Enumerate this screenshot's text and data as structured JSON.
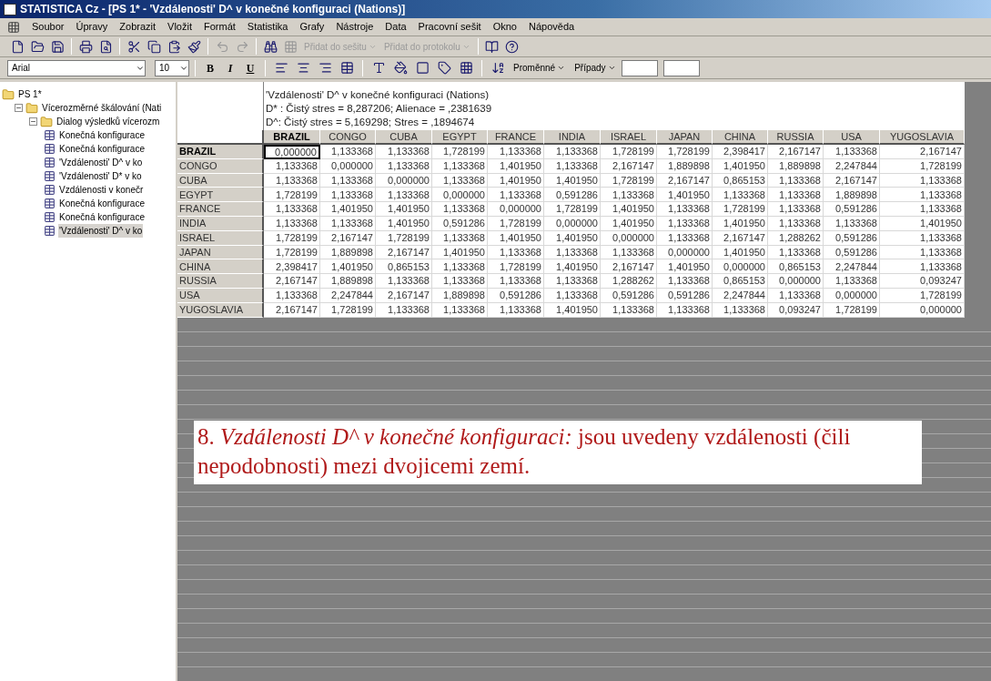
{
  "window": {
    "title": "STATISTICA Cz - [PS 1* - 'Vzdálenosti' D^ v konečné konfiguraci (Nations)]"
  },
  "menu": [
    "Soubor",
    "Úpravy",
    "Zobrazit",
    "Vložit",
    "Formát",
    "Statistika",
    "Grafy",
    "Nástroje",
    "Data",
    "Pracovní sešit",
    "Okno",
    "Nápověda"
  ],
  "toolbar": {
    "buttons": [
      {
        "label": "Přidat do sešitu",
        "disabled": true
      },
      {
        "label": "Přidat do protokolu",
        "disabled": true
      }
    ]
  },
  "format_toolbar": {
    "font": "Arial",
    "size": "10",
    "bold": "B",
    "italic": "I",
    "underline": "U",
    "dropdowns": [
      "Proměnné",
      "Případy"
    ]
  },
  "tree": [
    {
      "label": "PS 1*",
      "selected": false,
      "children": [
        {
          "label": "Vícerozměrné škálování (Nati",
          "expanded": true,
          "selected": false,
          "children": [
            {
              "label": "Dialog výsledků vícerozm",
              "expanded": true,
              "selected": false,
              "children": [
                {
                  "label": "Konečná konfigurace",
                  "selected": false
                },
                {
                  "label": "Konečná konfigurace",
                  "selected": false
                },
                {
                  "label": "'Vzdálenosti' D^ v ko",
                  "selected": false
                },
                {
                  "label": "'Vzdálenosti' D* v ko",
                  "selected": false
                },
                {
                  "label": "Vzdálenosti v konečr",
                  "selected": false
                },
                {
                  "label": "Konečná konfigurace",
                  "selected": false
                },
                {
                  "label": "Konečná konfigurace",
                  "selected": false
                },
                {
                  "label": "'Vzdálenosti' D^ v ko",
                  "selected": true
                }
              ]
            }
          ]
        }
      ]
    }
  ],
  "table": {
    "title_lines": [
      "'Vzdálenosti' D^ v konečné konfiguraci (Nations)",
      "D* : Čistý stres = 8,287206; Alienace = ,2381639",
      "D^: Čistý stres = 5,169298; Stres = ,1894674"
    ],
    "columns": [
      "BRAZIL",
      "CONGO",
      "CUBA",
      "EGYPT",
      "FRANCE",
      "INDIA",
      "ISRAEL",
      "JAPAN",
      "CHINA",
      "RUSSIA",
      "USA",
      "YUGOSLAVIA"
    ],
    "rows": [
      {
        "label": "BRAZIL",
        "cells": [
          {
            "value": "0,000000",
            "selected": true
          },
          {
            "value": "1,133368",
            "selected": false
          },
          {
            "value": "1,133368",
            "selected": false
          },
          {
            "value": "1,728199",
            "selected": false
          },
          {
            "value": "1,133368",
            "selected": false
          },
          {
            "value": "1,133368",
            "selected": false
          },
          {
            "value": "1,728199",
            "selected": false
          },
          {
            "value": "1,728199",
            "selected": false
          },
          {
            "value": "2,398417",
            "selected": false
          },
          {
            "value": "2,167147",
            "selected": false
          },
          {
            "value": "1,133368",
            "selected": false
          },
          {
            "value": "2,167147",
            "selected": false
          }
        ]
      },
      {
        "label": "CONGO",
        "cells": [
          {
            "value": "1,133368",
            "selected": false
          },
          {
            "value": "0,000000",
            "selected": false
          },
          {
            "value": "1,133368",
            "selected": false
          },
          {
            "value": "1,133368",
            "selected": false
          },
          {
            "value": "1,401950",
            "selected": false
          },
          {
            "value": "1,133368",
            "selected": false
          },
          {
            "value": "2,167147",
            "selected": false
          },
          {
            "value": "1,889898",
            "selected": false
          },
          {
            "value": "1,401950",
            "selected": false
          },
          {
            "value": "1,889898",
            "selected": false
          },
          {
            "value": "2,247844",
            "selected": false
          },
          {
            "value": "1,728199",
            "selected": false
          }
        ]
      },
      {
        "label": "CUBA",
        "cells": [
          {
            "value": "1,133368",
            "selected": false
          },
          {
            "value": "1,133368",
            "selected": false
          },
          {
            "value": "0,000000",
            "selected": false
          },
          {
            "value": "1,133368",
            "selected": false
          },
          {
            "value": "1,401950",
            "selected": false
          },
          {
            "value": "1,401950",
            "selected": false
          },
          {
            "value": "1,728199",
            "selected": false
          },
          {
            "value": "2,167147",
            "selected": false
          },
          {
            "value": "0,865153",
            "selected": false
          },
          {
            "value": "1,133368",
            "selected": false
          },
          {
            "value": "2,167147",
            "selected": false
          },
          {
            "value": "1,133368",
            "selected": false
          }
        ]
      },
      {
        "label": "EGYPT",
        "cells": [
          {
            "value": "1,728199",
            "selected": false
          },
          {
            "value": "1,133368",
            "selected": false
          },
          {
            "value": "1,133368",
            "selected": false
          },
          {
            "value": "0,000000",
            "selected": false
          },
          {
            "value": "1,133368",
            "selected": false
          },
          {
            "value": "0,591286",
            "selected": false
          },
          {
            "value": "1,133368",
            "selected": false
          },
          {
            "value": "1,401950",
            "selected": false
          },
          {
            "value": "1,133368",
            "selected": false
          },
          {
            "value": "1,133368",
            "selected": false
          },
          {
            "value": "1,889898",
            "selected": false
          },
          {
            "value": "1,133368",
            "selected": false
          }
        ]
      },
      {
        "label": "FRANCE",
        "cells": [
          {
            "value": "1,133368",
            "selected": false
          },
          {
            "value": "1,401950",
            "selected": false
          },
          {
            "value": "1,401950",
            "selected": false
          },
          {
            "value": "1,133368",
            "selected": false
          },
          {
            "value": "0,000000",
            "selected": false
          },
          {
            "value": "1,728199",
            "selected": false
          },
          {
            "value": "1,401950",
            "selected": false
          },
          {
            "value": "1,133368",
            "selected": false
          },
          {
            "value": "1,728199",
            "selected": false
          },
          {
            "value": "1,133368",
            "selected": false
          },
          {
            "value": "0,591286",
            "selected": false
          },
          {
            "value": "1,133368",
            "selected": false
          }
        ]
      },
      {
        "label": "INDIA",
        "cells": [
          {
            "value": "1,133368",
            "selected": false
          },
          {
            "value": "1,133368",
            "selected": false
          },
          {
            "value": "1,401950",
            "selected": false
          },
          {
            "value": "0,591286",
            "selected": false
          },
          {
            "value": "1,728199",
            "selected": false
          },
          {
            "value": "0,000000",
            "selected": false
          },
          {
            "value": "1,401950",
            "selected": false
          },
          {
            "value": "1,133368",
            "selected": false
          },
          {
            "value": "1,401950",
            "selected": false
          },
          {
            "value": "1,133368",
            "selected": false
          },
          {
            "value": "1,133368",
            "selected": false
          },
          {
            "value": "1,401950",
            "selected": false
          }
        ]
      },
      {
        "label": "ISRAEL",
        "cells": [
          {
            "value": "1,728199",
            "selected": false
          },
          {
            "value": "2,167147",
            "selected": false
          },
          {
            "value": "1,728199",
            "selected": false
          },
          {
            "value": "1,133368",
            "selected": false
          },
          {
            "value": "1,401950",
            "selected": false
          },
          {
            "value": "1,401950",
            "selected": false
          },
          {
            "value": "0,000000",
            "selected": false
          },
          {
            "value": "1,133368",
            "selected": false
          },
          {
            "value": "2,167147",
            "selected": false
          },
          {
            "value": "1,288262",
            "selected": false
          },
          {
            "value": "0,591286",
            "selected": false
          },
          {
            "value": "1,133368",
            "selected": false
          }
        ]
      },
      {
        "label": "JAPAN",
        "cells": [
          {
            "value": "1,728199",
            "selected": false
          },
          {
            "value": "1,889898",
            "selected": false
          },
          {
            "value": "2,167147",
            "selected": false
          },
          {
            "value": "1,401950",
            "selected": false
          },
          {
            "value": "1,133368",
            "selected": false
          },
          {
            "value": "1,133368",
            "selected": false
          },
          {
            "value": "1,133368",
            "selected": false
          },
          {
            "value": "0,000000",
            "selected": false
          },
          {
            "value": "1,401950",
            "selected": false
          },
          {
            "value": "1,133368",
            "selected": false
          },
          {
            "value": "0,591286",
            "selected": false
          },
          {
            "value": "1,133368",
            "selected": false
          }
        ]
      },
      {
        "label": "CHINA",
        "cells": [
          {
            "value": "2,398417",
            "selected": false
          },
          {
            "value": "1,401950",
            "selected": false
          },
          {
            "value": "0,865153",
            "selected": false
          },
          {
            "value": "1,133368",
            "selected": false
          },
          {
            "value": "1,728199",
            "selected": false
          },
          {
            "value": "1,401950",
            "selected": false
          },
          {
            "value": "2,167147",
            "selected": false
          },
          {
            "value": "1,401950",
            "selected": false
          },
          {
            "value": "0,000000",
            "selected": false
          },
          {
            "value": "0,865153",
            "selected": false
          },
          {
            "value": "2,247844",
            "selected": false
          },
          {
            "value": "1,133368",
            "selected": false
          }
        ]
      },
      {
        "label": "RUSSIA",
        "cells": [
          {
            "value": "2,167147",
            "selected": false
          },
          {
            "value": "1,889898",
            "selected": false
          },
          {
            "value": "1,133368",
            "selected": false
          },
          {
            "value": "1,133368",
            "selected": false
          },
          {
            "value": "1,133368",
            "selected": false
          },
          {
            "value": "1,133368",
            "selected": false
          },
          {
            "value": "1,288262",
            "selected": false
          },
          {
            "value": "1,133368",
            "selected": false
          },
          {
            "value": "0,865153",
            "selected": false
          },
          {
            "value": "0,000000",
            "selected": false
          },
          {
            "value": "1,133368",
            "selected": false
          },
          {
            "value": "0,093247",
            "selected": false
          }
        ]
      },
      {
        "label": "USA",
        "cells": [
          {
            "value": "1,133368",
            "selected": false
          },
          {
            "value": "2,247844",
            "selected": false
          },
          {
            "value": "2,167147",
            "selected": false
          },
          {
            "value": "1,889898",
            "selected": false
          },
          {
            "value": "0,591286",
            "selected": false
          },
          {
            "value": "1,133368",
            "selected": false
          },
          {
            "value": "0,591286",
            "selected": false
          },
          {
            "value": "0,591286",
            "selected": false
          },
          {
            "value": "2,247844",
            "selected": false
          },
          {
            "value": "1,133368",
            "selected": false
          },
          {
            "value": "0,000000",
            "selected": false
          },
          {
            "value": "1,728199",
            "selected": false
          }
        ]
      },
      {
        "label": "YUGOSLAVIA",
        "cells": [
          {
            "value": "2,167147",
            "selected": false
          },
          {
            "value": "1,728199",
            "selected": false
          },
          {
            "value": "1,133368",
            "selected": false
          },
          {
            "value": "1,133368",
            "selected": false
          },
          {
            "value": "1,133368",
            "selected": false
          },
          {
            "value": "1,401950",
            "selected": false
          },
          {
            "value": "1,133368",
            "selected": false
          },
          {
            "value": "1,133368",
            "selected": false
          },
          {
            "value": "1,133368",
            "selected": false
          },
          {
            "value": "0,093247",
            "selected": false
          },
          {
            "value": "1,728199",
            "selected": false
          },
          {
            "value": "0,000000",
            "selected": false
          }
        ]
      }
    ]
  },
  "caption": "8. *Vzdálenosti D^ v konečné konfiguraci:* jsou uvedeny vzdálenosti (čili nepodobnosti) mezi dvojicemi zemí."
}
